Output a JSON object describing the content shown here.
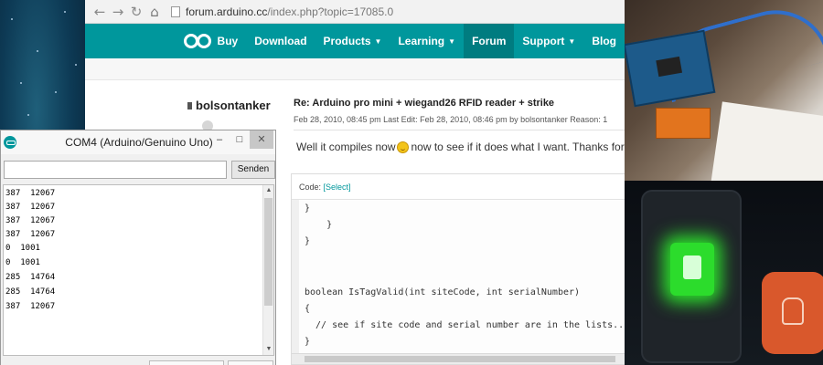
{
  "browser": {
    "url_domain": "forum.arduino.cc",
    "url_path": "/index.php?topic=17085.0",
    "nav_icons": [
      "back-arrow-icon",
      "forward-arrow-icon",
      "reload-icon",
      "page-icon"
    ]
  },
  "site_nav": {
    "items": [
      {
        "label": "Buy",
        "dropdown": false
      },
      {
        "label": "Download",
        "dropdown": false
      },
      {
        "label": "Products",
        "dropdown": true
      },
      {
        "label": "Learning",
        "dropdown": true
      },
      {
        "label": "Forum",
        "dropdown": false,
        "active": true
      },
      {
        "label": "Support",
        "dropdown": true
      },
      {
        "label": "Blog",
        "dropdown": false
      }
    ],
    "color": "#00979c",
    "active_color": "#007c80"
  },
  "post": {
    "author": "bolsontanker",
    "title": "Re: Arduino pro mini + wiegand26 RFID reader + strike",
    "meta": "Feb 28, 2010, 08:45 pm  Last Edit: Feb 28, 2010, 08:46 pm by bolsontanker Reason: 1",
    "body_before": "Well it compiles now",
    "body_after": "now to see if it does what I want.  Thanks for the help!",
    "code_label": "Code:",
    "code_select": "[Select]",
    "code_lines": [
      "}",
      "    }",
      "}",
      "",
      "",
      "boolean IsTagValid(int siteCode, int serialNumber)",
      "{",
      "  // see if site code and serial number are in the lists...",
      "}"
    ]
  },
  "serial_monitor": {
    "title": "COM4 (Arduino/Genuino Uno)",
    "input_value": "",
    "send_label": "Senden",
    "window_controls": {
      "minimize": "–",
      "maximize": "□",
      "close": "✕"
    },
    "output_lines": [
      "387  12067",
      "387  12067",
      "387  12067",
      "387  12067",
      "0  1001",
      "0  1001",
      "285  14764",
      "285  14764",
      "387  12067"
    ]
  }
}
